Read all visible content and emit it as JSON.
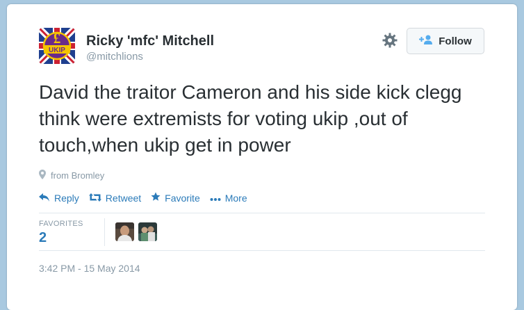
{
  "tweet": {
    "author_name": "Ricky 'mfc' Mitchell",
    "author_handle": "@mitchlions",
    "avatar_label": "UKIP",
    "follow_label": "Follow",
    "text": "David the traitor Cameron and his side kick clegg think were extremists for voting ukip ,out of touch,when ukip get in power",
    "location": "from Bromley",
    "actions": {
      "reply": "Reply",
      "retweet": "Retweet",
      "favorite": "Favorite",
      "more": "More"
    },
    "favorites_label": "FAVORITES",
    "favorites_count": "2",
    "timestamp": "3:42 PM - 15 May 2014"
  },
  "colors": {
    "link_blue": "#2b7bb9",
    "muted_gray": "#8899a6",
    "text_dark": "#292f33",
    "page_background": "#a9c9e0",
    "ukip_purple": "#6a2a8a",
    "ukip_yellow": "#f5c400"
  },
  "icons": {
    "settings": "gear-icon",
    "follow": "add-user-icon",
    "location": "location-pin-icon",
    "reply": "reply-icon",
    "retweet": "retweet-icon",
    "favorite": "star-icon",
    "more": "ellipsis-icon"
  }
}
